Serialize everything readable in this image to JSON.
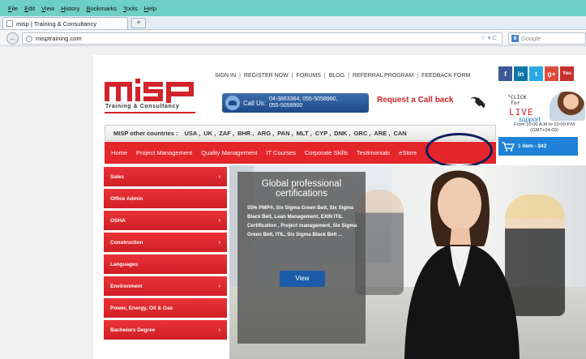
{
  "browser": {
    "menu": [
      "File",
      "Edit",
      "View",
      "History",
      "Bookmarks",
      "Tools",
      "Help"
    ],
    "tab_title": "misp | Training & Consultancy",
    "new_tab_label": "+",
    "back_label": "←",
    "url": "misptraining.com",
    "url_icons": "☆ ▾ C",
    "search_placeholder": "Google",
    "search_engine_letter": "8"
  },
  "header": {
    "logo_text": "misp",
    "logo_sub": "Training & Consultancy",
    "top_links": [
      "SIGN IN",
      "REGISTER NOW",
      "FORUMS",
      "BLOG",
      "REFERRAL PROGRAM",
      "FEEDBACK FORM"
    ],
    "link_separator": "|",
    "call_label": "Call Us:",
    "phone_line1": "04-3863364, 055-5058990,",
    "phone_line2": "055-5058900",
    "callback_label": "Request a Call back",
    "social": [
      "f",
      "in",
      "t",
      "g+",
      "You Tube"
    ],
    "livechat": {
      "click": "\"CLICK\n for",
      "live": "LIVE",
      "support": "support",
      "hours": "From 10:00 A.M to 10:00 P.M\n(GMT+04:00)"
    }
  },
  "countries": {
    "label": "MISP other countries :",
    "items": [
      "USA ,",
      "UK ,",
      "ZAF ,",
      "BHR ,",
      "ARG ,",
      "PAN ,",
      "MLT ,",
      "CYP ,",
      "DNK ,",
      "GRC ,",
      "ARE ,",
      "CAN"
    ]
  },
  "nav": [
    "Home",
    "Project Management",
    "Quality Management",
    "IT Courses",
    "Corporate Skills",
    "Testimonials",
    "eStore"
  ],
  "cart": {
    "label": "1 item - $42"
  },
  "sidebar": [
    {
      "label": "Sales",
      "arrow": "›"
    },
    {
      "label": "Office Admin",
      "arrow": ""
    },
    {
      "label": "OSHA",
      "arrow": "›"
    },
    {
      "label": "Construction",
      "arrow": "›"
    },
    {
      "label": "Languages",
      "arrow": ""
    },
    {
      "label": "Environment",
      "arrow": "›"
    },
    {
      "label": "Power, Energy, Oil & Gas",
      "arrow": ""
    },
    {
      "label": "Bachelors Degree",
      "arrow": "›"
    }
  ],
  "hero": {
    "title": "Global professional certifications",
    "text": "55% PMP®, Six Sigma Green Belt, Six Sigma Black Belt, Lean Management, EXIN ITIL Certification , Project management, Six Sigma Green Belt, ITIL, Six Sigma Black Belt ...",
    "button": "View"
  },
  "colors": {
    "brand_red": "#e4262b",
    "nav_blue": "#1f82d6",
    "highlight_ring": "#0f1f5c"
  }
}
